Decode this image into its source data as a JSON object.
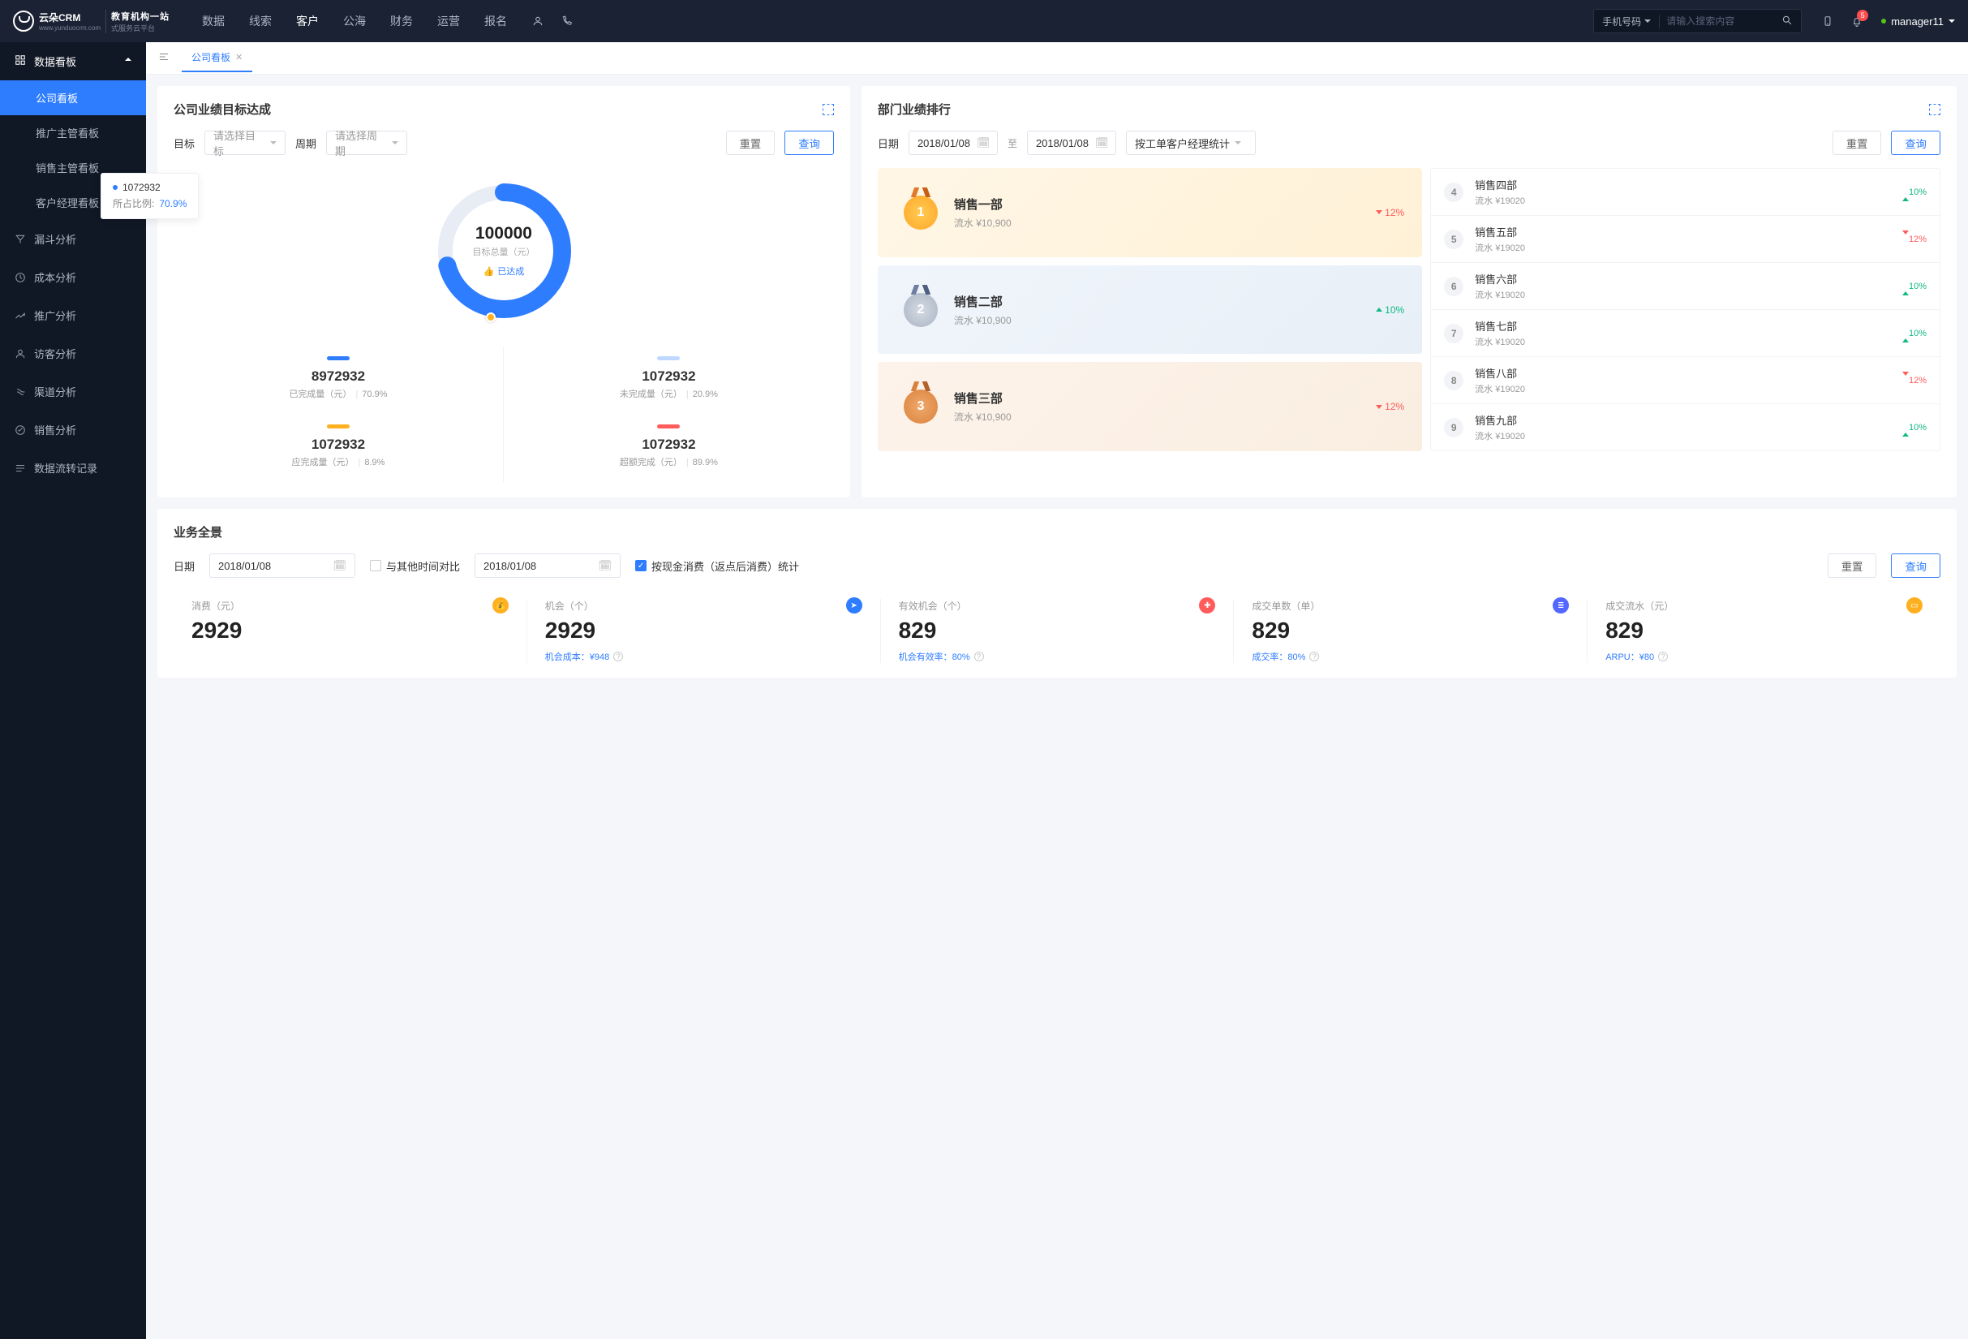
{
  "topnav": {
    "brand": "云朵CRM",
    "brand_sub1": "教育机构一站",
    "brand_sub2": "式服务云平台",
    "brand_url": "www.yunduocrm.com",
    "menu": [
      "数据",
      "线索",
      "客户",
      "公海",
      "财务",
      "运营",
      "报名"
    ],
    "menu_active": 2,
    "search_type": "手机号码",
    "search_placeholder": "请输入搜索内容",
    "badge": "5",
    "user": "manager11"
  },
  "sidebar": {
    "header": "数据看板",
    "subs": [
      "公司看板",
      "推广主管看板",
      "销售主管看板",
      "客户经理看板"
    ],
    "sub_active": 0,
    "items": [
      "漏斗分析",
      "成本分析",
      "推广分析",
      "访客分析",
      "渠道分析",
      "销售分析",
      "数据流转记录"
    ]
  },
  "tab": {
    "name": "公司看板"
  },
  "target": {
    "title": "公司业绩目标达成",
    "label_goal": "目标",
    "goal_placeholder": "请选择目标",
    "label_period": "周期",
    "period_placeholder": "请选择周期",
    "btn_reset": "重置",
    "btn_query": "查询",
    "chart": {
      "total": "100000",
      "total_label": "目标总量（元）",
      "reached_label": "已达成",
      "tooltip_value": "1072932",
      "tooltip_label": "所占比例:",
      "tooltip_pct": "70.9%",
      "progress_pct": 70.9
    },
    "cells": [
      {
        "color": "#2e7dff",
        "value": "8972932",
        "label": "已完成量（元）",
        "pct": "70.9%"
      },
      {
        "color": "#bfd8ff",
        "value": "1072932",
        "label": "未完成量（元）",
        "pct": "20.9%"
      },
      {
        "color": "#ffb020",
        "value": "1072932",
        "label": "应完成量（元）",
        "pct": "8.9%"
      },
      {
        "color": "#ff5c5c",
        "value": "1072932",
        "label": "超额完成（元）",
        "pct": "89.9%"
      }
    ]
  },
  "rank": {
    "title": "部门业绩排行",
    "label_date": "日期",
    "date_from": "2018/01/08",
    "date_sep": "至",
    "date_to": "2018/01/08",
    "stat_by": "按工单客户经理统计",
    "btn_reset": "重置",
    "btn_query": "查询",
    "podium": [
      {
        "name": "销售一部",
        "amt": "流水 ¥10,900",
        "pct": "12%",
        "dir": "down"
      },
      {
        "name": "销售二部",
        "amt": "流水 ¥10,900",
        "pct": "10%",
        "dir": "up"
      },
      {
        "name": "销售三部",
        "amt": "流水 ¥10,900",
        "pct": "12%",
        "dir": "down"
      }
    ],
    "list": [
      {
        "n": "4",
        "name": "销售四部",
        "amt": "流水 ¥19020",
        "pct": "10%",
        "dir": "up"
      },
      {
        "n": "5",
        "name": "销售五部",
        "amt": "流水 ¥19020",
        "pct": "12%",
        "dir": "down"
      },
      {
        "n": "6",
        "name": "销售六部",
        "amt": "流水 ¥19020",
        "pct": "10%",
        "dir": "up"
      },
      {
        "n": "7",
        "name": "销售七部",
        "amt": "流水 ¥19020",
        "pct": "10%",
        "dir": "up"
      },
      {
        "n": "8",
        "name": "销售八部",
        "amt": "流水 ¥19020",
        "pct": "12%",
        "dir": "down"
      },
      {
        "n": "9",
        "name": "销售九部",
        "amt": "流水 ¥19020",
        "pct": "10%",
        "dir": "up"
      }
    ]
  },
  "overview": {
    "title": "业务全景",
    "label_date": "日期",
    "date1": "2018/01/08",
    "compare_label": "与其他时间对比",
    "date2": "2018/01/08",
    "cash_label": "按现金消费（返点后消费）统计",
    "btn_reset": "重置",
    "btn_query": "查询",
    "kpis": [
      {
        "ttl": "消费（元）",
        "val": "2929",
        "sub": "",
        "ic": "#ffb020",
        "glyph": "💰"
      },
      {
        "ttl": "机会（个）",
        "val": "2929",
        "sub": "机会成本：¥948",
        "ic": "#2e7dff",
        "glyph": "➤"
      },
      {
        "ttl": "有效机会（个）",
        "val": "829",
        "sub": "机会有效率：80%",
        "ic": "#ff5c5c",
        "glyph": "✚"
      },
      {
        "ttl": "成交单数（单）",
        "val": "829",
        "sub": "成交率：80%",
        "ic": "#5468ff",
        "glyph": "≣"
      },
      {
        "ttl": "成交流水（元）",
        "val": "829",
        "sub": "ARPU：¥80",
        "ic": "#ffb020",
        "glyph": "▭"
      }
    ]
  },
  "chart_data": {
    "type": "pie",
    "title": "公司业绩目标达成",
    "total_target": 100000,
    "series": [
      {
        "name": "已完成量",
        "value": 8972932,
        "pct": 70.9,
        "color": "#2e7dff"
      },
      {
        "name": "未完成量",
        "value": 1072932,
        "pct": 20.9,
        "color": "#bfd8ff"
      },
      {
        "name": "应完成量",
        "value": 1072932,
        "pct": 8.9,
        "color": "#ffb020"
      },
      {
        "name": "超额完成",
        "value": 1072932,
        "pct": 89.9,
        "color": "#ff5c5c"
      }
    ],
    "highlighted": {
      "value": 1072932,
      "pct": 70.9
    }
  }
}
